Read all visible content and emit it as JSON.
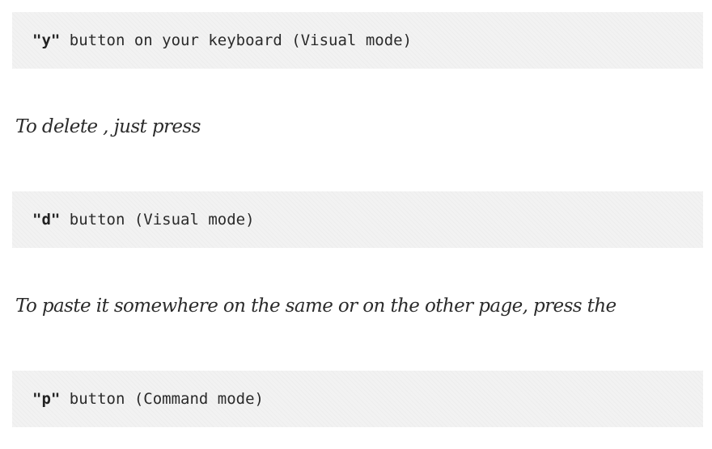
{
  "blocks": [
    {
      "key": "\"y\"",
      "text": " button on your keyboard (Visual mode)"
    },
    {
      "key": "\"d\"",
      "text": " button (Visual mode)"
    },
    {
      "key": "\"p\"",
      "text": " button (Command mode)"
    }
  ],
  "paragraphs": [
    "To delete , just press",
    "To paste it somewhere on the same or on the other page, press the"
  ]
}
